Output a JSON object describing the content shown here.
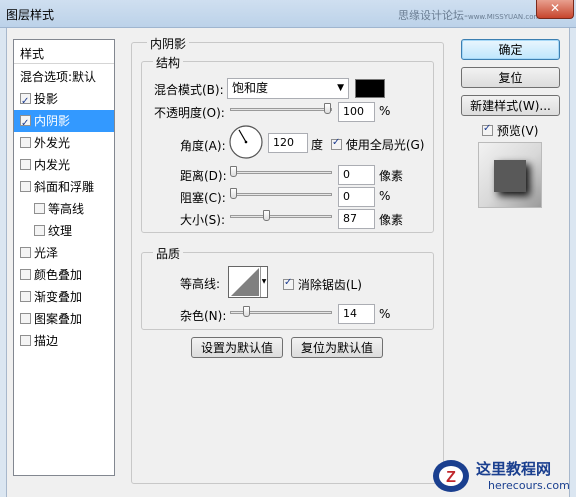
{
  "window": {
    "title": "图层样式",
    "watermark": "思缘设计论坛",
    "watermark_site": "www.MISSYUAN.com",
    "close_glyph": "✕"
  },
  "styles_header": "样式",
  "style_items": [
    {
      "label": "混合选项:默认",
      "has_checkbox": false,
      "checked": false,
      "selected": false
    },
    {
      "label": "投影",
      "has_checkbox": true,
      "checked": true,
      "selected": false
    },
    {
      "label": "内阴影",
      "has_checkbox": true,
      "checked": true,
      "selected": true
    },
    {
      "label": "外发光",
      "has_checkbox": true,
      "checked": false,
      "selected": false
    },
    {
      "label": "内发光",
      "has_checkbox": true,
      "checked": false,
      "selected": false
    },
    {
      "label": "斜面和浮雕",
      "has_checkbox": true,
      "checked": false,
      "selected": false
    },
    {
      "label": "等高线",
      "has_checkbox": true,
      "checked": false,
      "selected": false
    },
    {
      "label": "纹理",
      "has_checkbox": true,
      "checked": false,
      "selected": false
    },
    {
      "label": "光泽",
      "has_checkbox": true,
      "checked": false,
      "selected": false
    },
    {
      "label": "颜色叠加",
      "has_checkbox": true,
      "checked": false,
      "selected": false
    },
    {
      "label": "渐变叠加",
      "has_checkbox": true,
      "checked": false,
      "selected": false
    },
    {
      "label": "图案叠加",
      "has_checkbox": true,
      "checked": false,
      "selected": false
    },
    {
      "label": "描边",
      "has_checkbox": true,
      "checked": false,
      "selected": false
    }
  ],
  "inner_shadow": {
    "title": "内阴影",
    "structure": {
      "title": "结构",
      "blend_mode_label": "混合模式(B):",
      "blend_mode": "饱和度",
      "shadow_color": "#000000",
      "opacity_label": "不透明度(O):",
      "opacity": "100",
      "opacity_fraction": 1.0,
      "opacity_unit": "%",
      "angle_label": "角度(A):",
      "angle": "120",
      "angle_unit": "度",
      "global_light_label": "使用全局光(G)",
      "global_light": true,
      "distance_label": "距离(D):",
      "distance": "0",
      "distance_fraction": 0.0,
      "distance_unit": "像素",
      "choke_label": "阻塞(C):",
      "choke": "0",
      "choke_fraction": 0.0,
      "choke_unit": "%",
      "size_label": "大小(S):",
      "size": "87",
      "size_fraction": 0.35,
      "size_unit": "像素"
    },
    "quality": {
      "title": "品质",
      "contour_label": "等高线:",
      "antialias_label": "消除锯齿(L)",
      "antialias": true,
      "noise_label": "杂色(N):",
      "noise": "14",
      "noise_fraction": 0.14,
      "noise_unit": "%"
    },
    "make_default_label": "设置为默认值",
    "reset_default_label": "复位为默认值"
  },
  "buttons": {
    "ok": "确定",
    "reset": "复位",
    "new_style": "新建样式(W)...",
    "preview_label": "预览(V)",
    "preview": true
  },
  "footer": {
    "logo_text": "这里教程网",
    "logo_url": "herecours.com"
  }
}
